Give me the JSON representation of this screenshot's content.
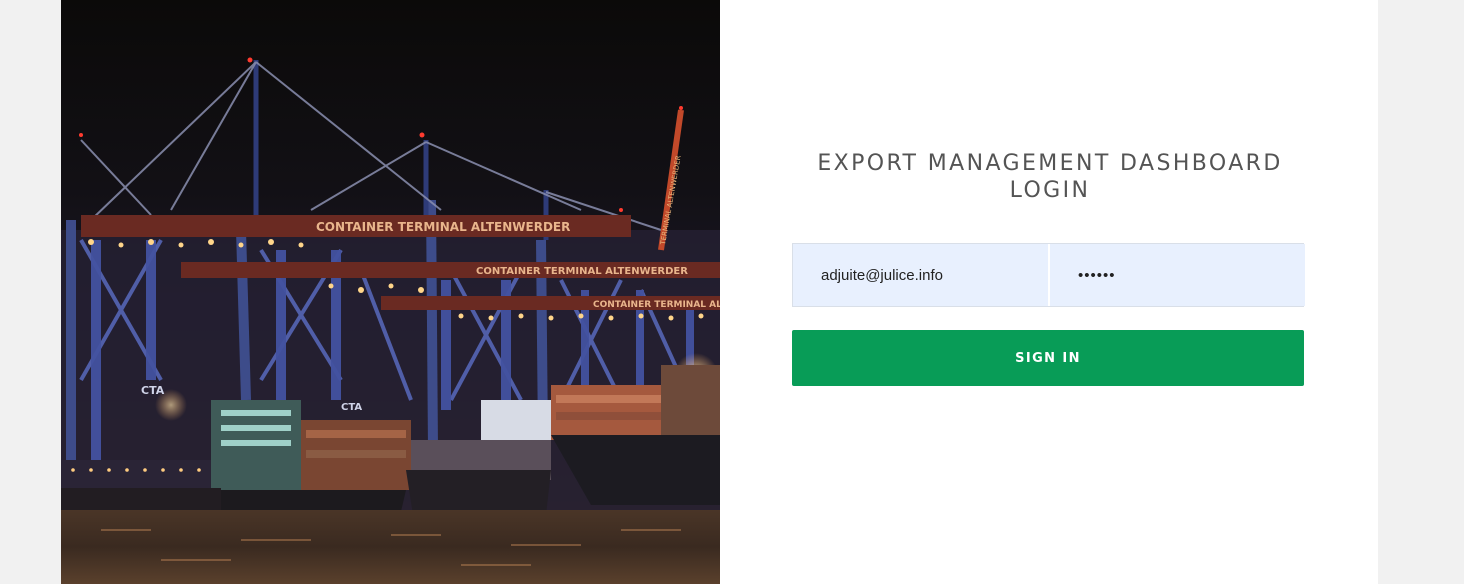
{
  "login": {
    "title_line1": "EXPORT MANAGEMENT DASHBOARD",
    "title_line2": "LOGIN",
    "email_value": "adjuite@julice.info",
    "password_value": "••••••",
    "signin_label": "SIGN IN"
  },
  "hero_image": {
    "sign_main": "CONTAINER TERMINAL ALTENWERDER",
    "sign_second": "CONTAINER TERMINAL ALTENWERDER",
    "sign_third": "CONTAINER TERMINAL ALTENWERDER",
    "crane_logo": "CTA",
    "crane_text": "TERMINAL ALTENWERDER"
  },
  "colors": {
    "page_background": "#f1f1f1",
    "panel_background": "#ffffff",
    "field_background": "#e8f0fe",
    "button_background": "#089c57",
    "title_color": "#545454"
  }
}
